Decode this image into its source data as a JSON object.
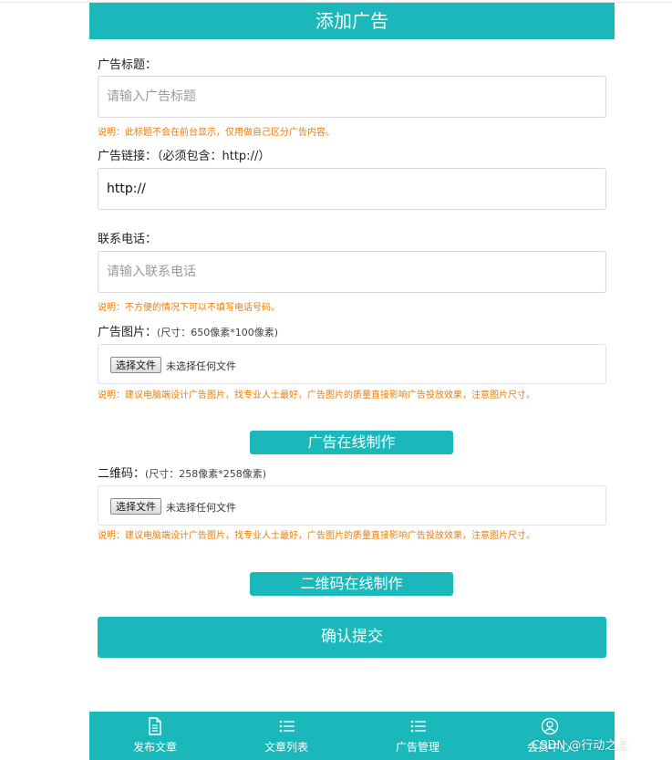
{
  "header": {
    "title": "添加广告"
  },
  "form": {
    "title_label": "广告标题：",
    "title_placeholder": "请输入广告标题",
    "title_note": "说明：此标题不会在前台显示，仅用做自己区分广告内容。",
    "link_label": "广告链接：（必须包含：http://）",
    "link_value": "http://",
    "phone_label": "联系电话：",
    "phone_placeholder": "请输入联系电话",
    "phone_note": "说明：不方便的情况下可以不填写电话号码。",
    "image_label": "广告图片：",
    "image_size": "(尺寸：650像素*100像素)",
    "image_file_button": "选择文件",
    "image_file_status": "未选择任何文件",
    "image_note": "说明：建议电脑端设计广告图片，找专业人士最好，广告图片的质量直接影响广告投放效果，注意图片尺寸。",
    "image_online_button": "广告在线制作",
    "qr_label": "二维码：",
    "qr_size": "(尺寸：258像素*258像素)",
    "qr_file_button": "选择文件",
    "qr_file_status": "未选择任何文件",
    "qr_note": "说明：建议电脑端设计广告图片，找专业人士最好，广告图片的质量直接影响广告投放效果，注意图片尺寸。",
    "qr_online_button": "二维码在线制作",
    "submit_label": "确认提交"
  },
  "nav": {
    "items": [
      {
        "label": "发布文章",
        "icon": "document-icon"
      },
      {
        "label": "文章列表",
        "icon": "list-icon"
      },
      {
        "label": "广告管理",
        "icon": "list-icon"
      },
      {
        "label": "会员中心",
        "icon": "user-icon"
      }
    ]
  },
  "watermark": "CSDN @行动之上",
  "colors": {
    "accent": "#1bb8bb",
    "note": "#f07c00"
  }
}
